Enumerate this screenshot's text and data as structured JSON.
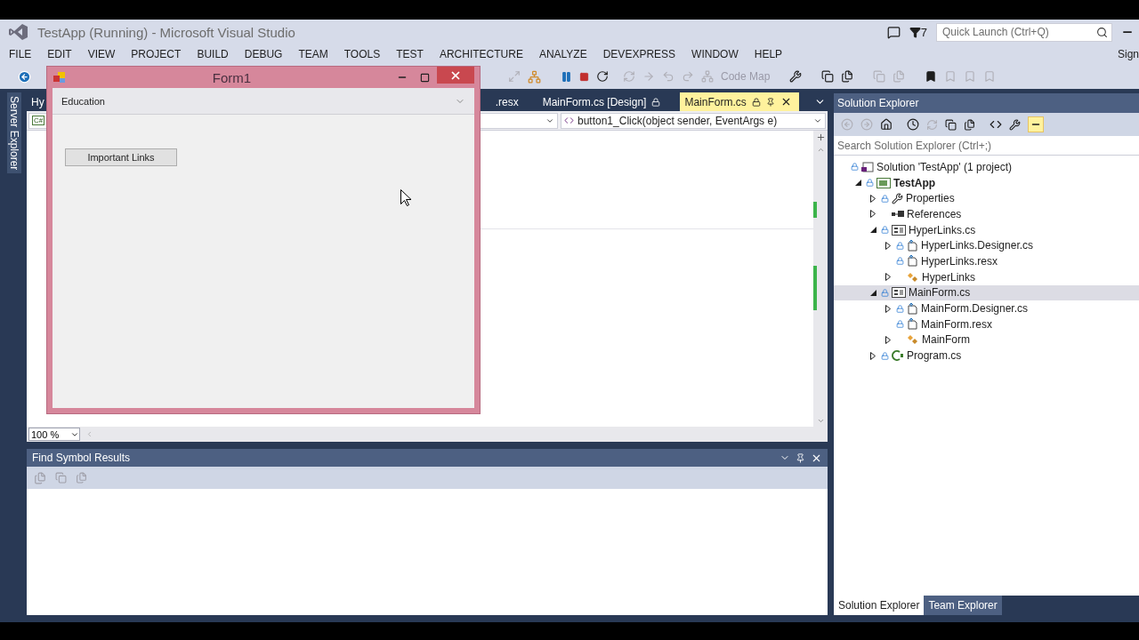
{
  "window": {
    "title": "TestApp (Running) - Microsoft Visual Studio"
  },
  "title_bar": {
    "notification_count": "7",
    "quick_launch": {
      "placeholder": "Quick Launch (Ctrl+Q)"
    }
  },
  "menu": [
    "FILE",
    "EDIT",
    "VIEW",
    "PROJECT",
    "BUILD",
    "DEBUG",
    "TEAM",
    "TOOLS",
    "TEST",
    "ARCHITECTURE",
    "ANALYZE",
    "DEVEXPRESS",
    "WINDOW",
    "HELP"
  ],
  "account": "Sign",
  "toolbar": {
    "code_map": "Code Map"
  },
  "side_tabs": [
    "Server Explorer"
  ],
  "editor": {
    "tabs": [
      {
        "label": "Hy",
        "selected": false,
        "kind": "plain"
      },
      {
        "label": ".resx",
        "selected": false,
        "kind": "plain"
      },
      {
        "label": "MainForm.cs [Design]",
        "selected": false,
        "kind": "locked"
      },
      {
        "label": "MainForm.cs",
        "selected": true,
        "kind": "active"
      }
    ],
    "file_type": "C#",
    "member": "button1_Click(object sender, EventArgs e)",
    "zoom": "100 %"
  },
  "find_symbol_results": {
    "title": "Find Symbol Results"
  },
  "solution_explorer": {
    "title": "Solution Explorer",
    "search": {
      "placeholder": "Search Solution Explorer (Ctrl+;)"
    },
    "tree": [
      {
        "label": "Solution 'TestApp' (1 project)",
        "kind": "solution",
        "locked": true,
        "selected": false,
        "children": [
          {
            "label": "TestApp",
            "kind": "project",
            "locked": true,
            "expanded": true,
            "selected": false,
            "children": [
              {
                "label": "Properties",
                "kind": "properties",
                "locked": true,
                "expanded": false,
                "selected": false
              },
              {
                "label": "References",
                "kind": "references",
                "locked": false,
                "expanded": false,
                "selected": false
              },
              {
                "label": "HyperLinks.cs",
                "kind": "form",
                "locked": true,
                "expanded": true,
                "selected": false,
                "children": [
                  {
                    "label": "HyperLinks.Designer.cs",
                    "kind": "file",
                    "locked": true,
                    "expanded": false,
                    "selected": false
                  },
                  {
                    "label": "HyperLinks.resx",
                    "kind": "file",
                    "locked": true,
                    "selected": false
                  },
                  {
                    "label": "HyperLinks",
                    "kind": "class",
                    "locked": false,
                    "expanded": false,
                    "selected": false
                  }
                ]
              },
              {
                "label": "MainForm.cs",
                "kind": "form",
                "locked": true,
                "expanded": true,
                "selected": true,
                "children": [
                  {
                    "label": "MainForm.Designer.cs",
                    "kind": "file",
                    "locked": true,
                    "expanded": false,
                    "selected": false
                  },
                  {
                    "label": "MainForm.resx",
                    "kind": "file",
                    "locked": true,
                    "selected": false
                  },
                  {
                    "label": "MainForm",
                    "kind": "class",
                    "locked": false,
                    "expanded": false,
                    "selected": false
                  }
                ]
              },
              {
                "label": "Program.cs",
                "kind": "program",
                "locked": true,
                "expanded": false,
                "selected": false
              }
            ]
          }
        ]
      }
    ],
    "bottom_tabs": [
      {
        "label": "Solution Explorer",
        "selected": true
      },
      {
        "label": "Team Explorer",
        "selected": false
      }
    ]
  },
  "form_window": {
    "title": "Form1",
    "menu": [
      "Education"
    ],
    "buttons": [
      "Important Links"
    ]
  }
}
